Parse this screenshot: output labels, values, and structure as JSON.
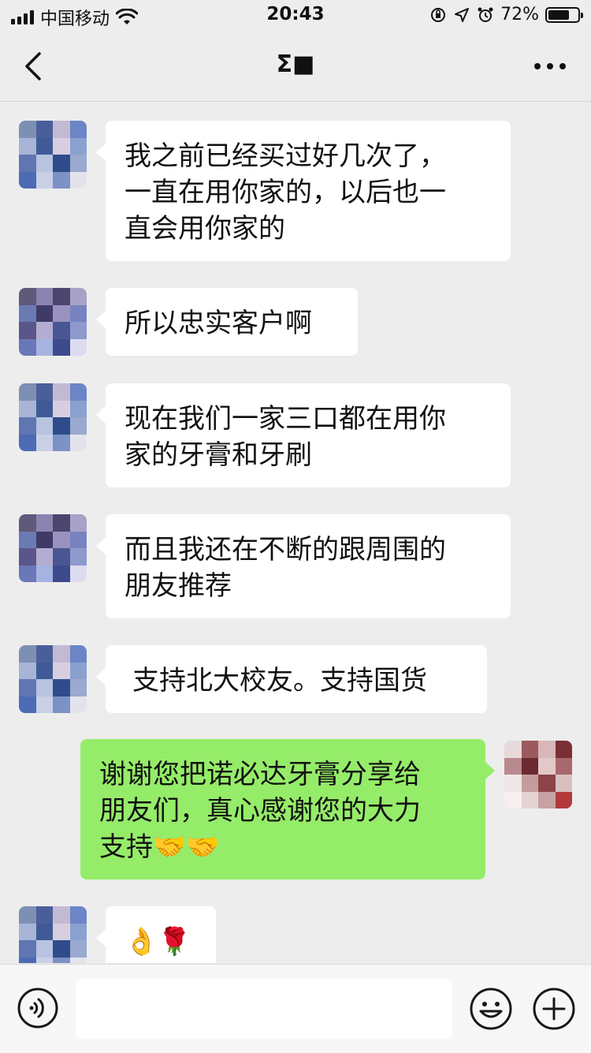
{
  "status_bar": {
    "carrier": "中国移动",
    "time": "20:43",
    "battery_percent": "72%",
    "battery_level": 0.72,
    "icons": [
      "signal-icon",
      "wifi-icon",
      "orientation-lock-icon",
      "location-icon",
      "alarm-icon",
      "battery-icon"
    ]
  },
  "nav": {
    "title": "Σ■",
    "back_icon": "chevron-left-icon",
    "more_icon": "more-dots-icon"
  },
  "messages": [
    {
      "side": "left",
      "text": "我之前已经买过好几次了，\n一直在用你家的，以后也一\n直会用你家的"
    },
    {
      "side": "left",
      "text": "所以忠实客户啊"
    },
    {
      "side": "left",
      "text": "现在我们一家三口都在用你\n家的牙膏和牙刷"
    },
    {
      "side": "left",
      "text": "而且我还在不断的跟周围的\n朋友推荐"
    },
    {
      "side": "left",
      "text": "支持北大校友。支持国货"
    },
    {
      "side": "right",
      "text": "谢谢您把诺必达牙膏分享给\n朋友们，真心感谢您的大力\n支持🤝🤝"
    },
    {
      "side": "left",
      "text": "👌🌹"
    }
  ],
  "input_bar": {
    "voice_icon": "voice-icon",
    "emoji_icon": "emoji-face-icon",
    "plus_icon": "plus-circle-icon",
    "input_value": ""
  },
  "colors": {
    "background": "#ededed",
    "sent_bubble": "#95ec69",
    "received_bubble": "#ffffff"
  }
}
